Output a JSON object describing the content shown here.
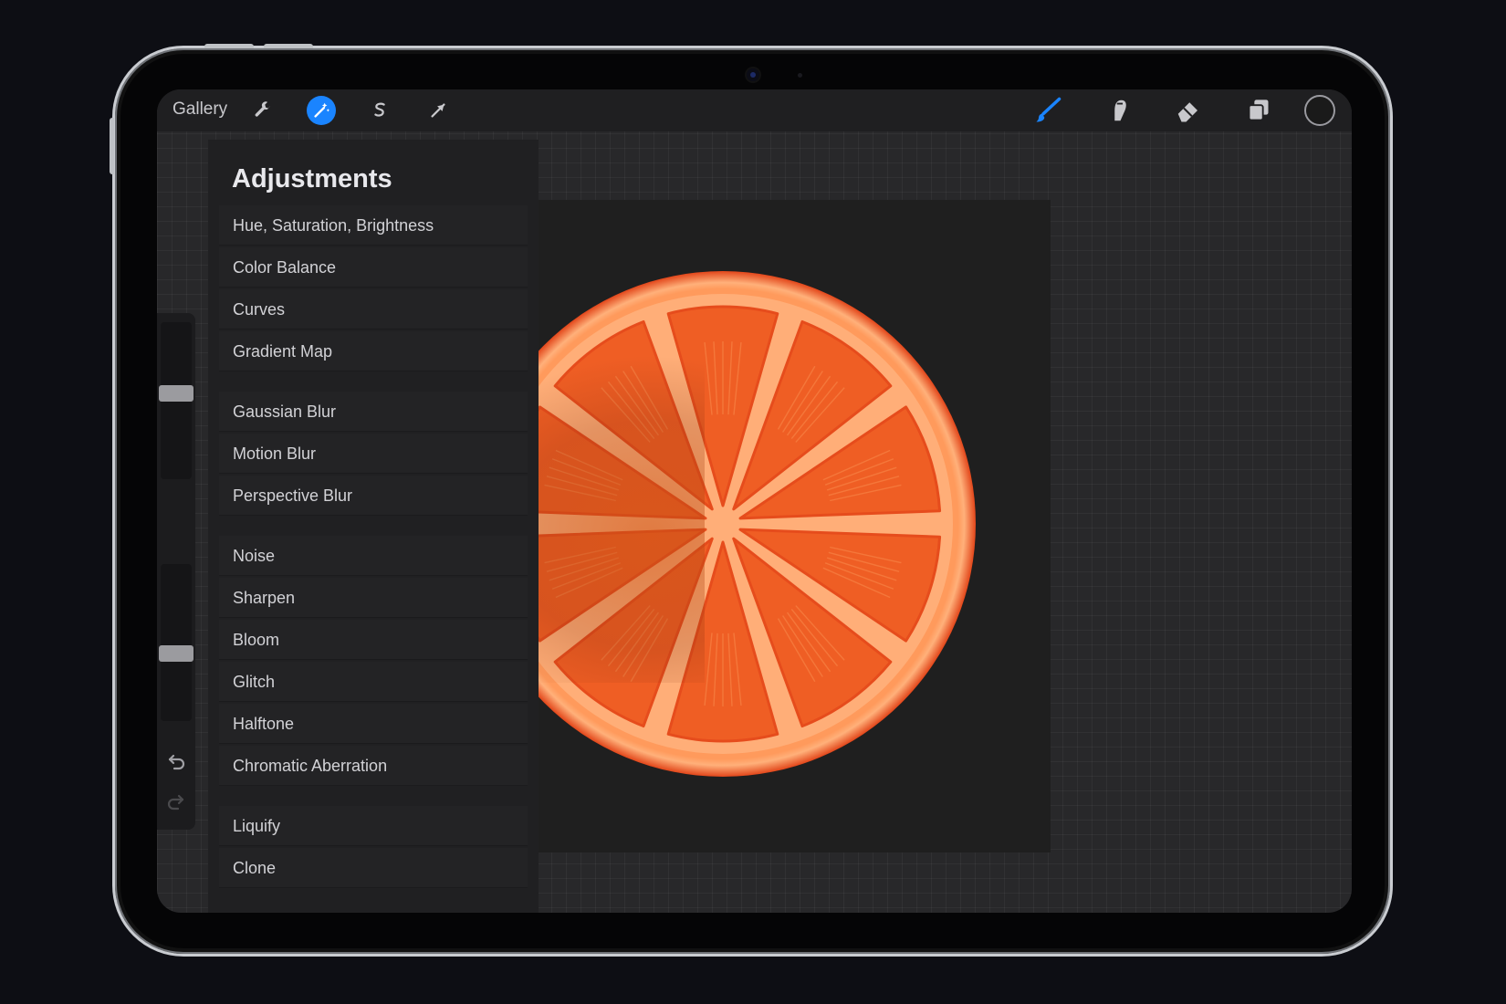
{
  "toolbar": {
    "gallery_label": "Gallery",
    "tools_left": [
      {
        "name": "actions",
        "icon": "wrench-icon",
        "active": false
      },
      {
        "name": "adjustments",
        "icon": "magic-wand-icon",
        "active": true
      },
      {
        "name": "selection",
        "icon": "selection-s-icon",
        "active": false
      },
      {
        "name": "transform",
        "icon": "arrow-cursor-icon",
        "active": false
      }
    ],
    "tools_right": [
      {
        "name": "brush",
        "icon": "brush-icon"
      },
      {
        "name": "smudge",
        "icon": "smudge-finger-icon"
      },
      {
        "name": "eraser",
        "icon": "eraser-icon"
      },
      {
        "name": "layers",
        "icon": "layers-icon"
      },
      {
        "name": "color",
        "icon": "color-well-icon"
      }
    ]
  },
  "colors": {
    "accent": "#1a84ff",
    "brush_active": "#1a84ff",
    "orange_peel": "#e0501a",
    "orange_flesh": "#f06a2a",
    "pith": "#ffb07a"
  },
  "adjustments_panel": {
    "title": "Adjustments",
    "groups": [
      [
        "Hue, Saturation, Brightness",
        "Color Balance",
        "Curves",
        "Gradient Map"
      ],
      [
        "Gaussian Blur",
        "Motion Blur",
        "Perspective Blur"
      ],
      [
        "Noise",
        "Sharpen",
        "Bloom",
        "Glitch",
        "Halftone",
        "Chromatic Aberration"
      ],
      [
        "Liquify",
        "Clone"
      ]
    ]
  },
  "sidebar": {
    "brush_size_level": 0.55,
    "opacity_level": 0.42,
    "undo_icon": "undo-arrow-icon",
    "redo_icon": "redo-arrow-icon",
    "modifier_icon": "modifier-square-icon"
  }
}
